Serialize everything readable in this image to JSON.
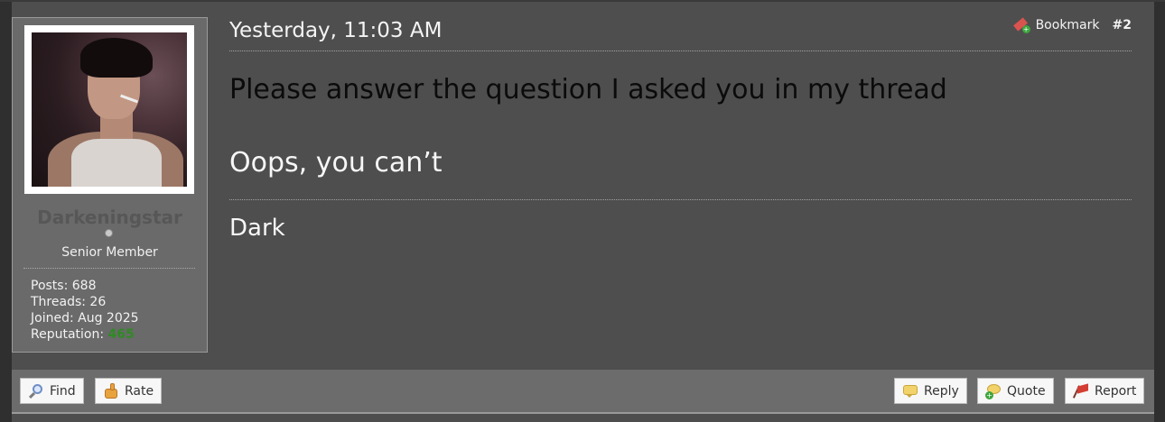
{
  "post": {
    "date": "Yesterday, 11:03 AM",
    "bookmark_label": "Bookmark",
    "post_number": "#2",
    "message_lines": [
      "Please answer the question I asked you in my thread",
      "Oops, you can’t"
    ],
    "signature": "Dark"
  },
  "user": {
    "username": "Darkeningstar",
    "title": "Senior Member",
    "posts_label": "Posts:",
    "posts": "688",
    "threads_label": "Threads:",
    "threads": "26",
    "joined_label": "Joined:",
    "joined": "Aug 2025",
    "reputation_label": "Reputation:",
    "reputation": "465",
    "status": "offline"
  },
  "buttons": {
    "find": "Find",
    "rate": "Rate",
    "reply": "Reply",
    "quote": "Quote",
    "report": "Report"
  },
  "icons": {
    "bookmark": "bookmark-add-icon",
    "find": "magnifier-icon",
    "rate": "thumbs-up-icon",
    "reply": "speech-bubble-icon",
    "quote": "quote-add-icon",
    "report": "red-flag-icon"
  },
  "colors": {
    "reputation": "#2f8a24",
    "post_background": "#4e4e4e",
    "userinfo_background": "#6a6a6a"
  }
}
